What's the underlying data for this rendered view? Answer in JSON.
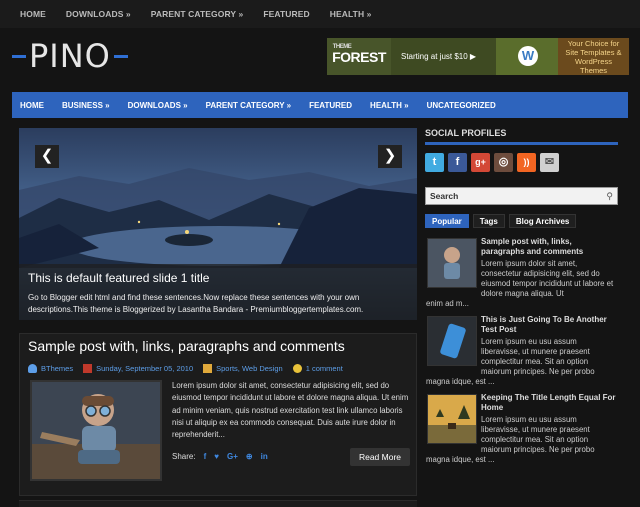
{
  "top_nav": [
    "HOME",
    "DOWNLOADS »",
    "PARENT CATEGORY »",
    "FEATURED",
    "HEALTH »"
  ],
  "logo": "PINO",
  "ad": {
    "brand": "FOREST",
    "brand_small": "THEME",
    "tagline": "Starting at just $10 ▶",
    "choice": "Your Choice for Site Templates & WordPress Themes"
  },
  "main_nav": [
    "HOME",
    "BUSINESS »",
    "DOWNLOADS »",
    "PARENT CATEGORY »",
    "FEATURED",
    "HEALTH »",
    "UNCATEGORIZED"
  ],
  "slider": {
    "prev": "❮",
    "next": "❯",
    "title": "This is default featured slide 1 title",
    "desc": "Go to Blogger edit html and find these sentences.Now replace these sentences with your own descriptions.This theme is Bloggerized by Lasantha Bandara - Premiumbloggertemplates.com."
  },
  "post": {
    "title": "Sample post with, links, paragraphs and comments",
    "author": "BThemes",
    "date": "Sunday, September 05, 2010",
    "labels": "Sports, Web Design",
    "comments": "1 comment",
    "excerpt": "Lorem ipsum dolor sit amet, consectetur adipisicing elit, sed do eiusmod tempor incididunt ut labore et dolore magna aliqua. Ut enim ad minim veniam, quis nostrud exercitation test link ullamco laboris nisi ut aliquip ex ea commodo consequat. Duis aute irure dolor in reprehenderit...",
    "share_label": "Share:",
    "share_icons": [
      "f",
      "♥",
      "G+",
      "⊕",
      "in"
    ],
    "read_more": "Read More"
  },
  "sidebar": {
    "social_heading": "SOCIAL PROFILES",
    "social_icons": [
      "twitter-icon",
      "facebook-icon",
      "google-plus-icon",
      "instagram-icon",
      "rss-icon",
      "email-icon"
    ],
    "social_glyphs": [
      "t",
      "f",
      "g+",
      "◎",
      "))",
      "✉"
    ],
    "social_colors": [
      "#41abe1",
      "#3b5998",
      "#d34836",
      "#6d4c3d",
      "#f26522",
      "#d0d0d0"
    ],
    "search_label": "Search",
    "tabs": [
      "Popular",
      "Tags",
      "Blog Archives"
    ],
    "posts": [
      {
        "title": "Sample post with, links, paragraphs and comments",
        "excerpt": "Lorem ipsum dolor sit amet, consectetur adipisicing elit, sed do eiusmod tempor incididunt ut labore et dolore magna aliqua. Ut",
        "tail": "enim ad m..."
      },
      {
        "title": "This is Just Going To Be Another Test Post",
        "excerpt": "Lorem ipsum eu usu assum liberavisse, ut munere praesent complectitur mea. Sit an option maiorum principes. Ne per probo",
        "tail": "magna idque, est ..."
      },
      {
        "title": "Keeping The Title Length Equal For Home",
        "excerpt": "Lorem ipsum eu usu assum liberavisse, ut munere praesent complectitur mea. Sit an option maiorum principes. Ne per probo",
        "tail": "magna idque, est ..."
      }
    ]
  },
  "colors": {
    "accent": "#2e64bd",
    "link": "#5d9ee8",
    "background": "#141414"
  }
}
